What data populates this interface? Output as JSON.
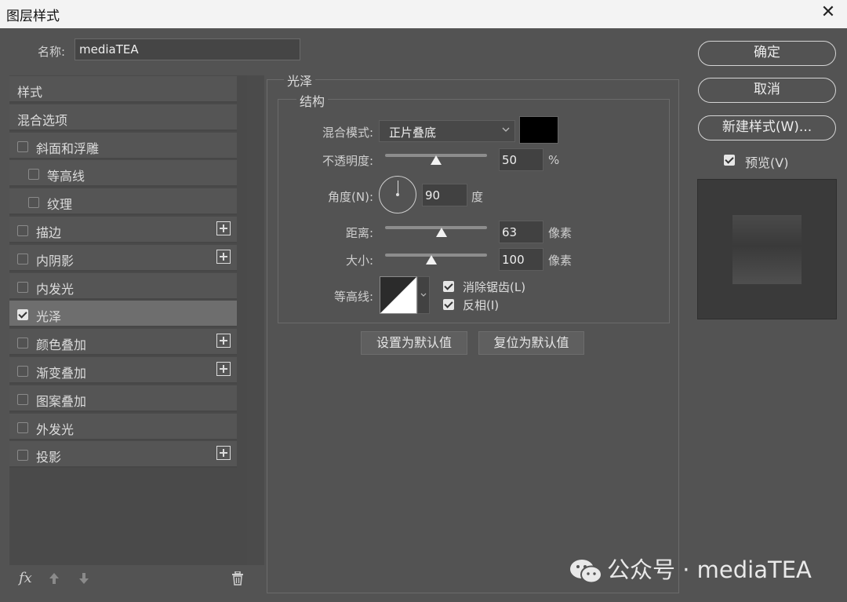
{
  "window": {
    "title": "图层样式",
    "close_glyph": "✕"
  },
  "name_field": {
    "label": "名称:",
    "value": "mediaTEA"
  },
  "styles_list": [
    {
      "label": "样式",
      "has_checkbox": false,
      "checked": false,
      "has_plus": false,
      "selected": false
    },
    {
      "label": "混合选项",
      "has_checkbox": false,
      "checked": false,
      "has_plus": false,
      "selected": false
    },
    {
      "label": "斜面和浮雕",
      "has_checkbox": true,
      "checked": false,
      "has_plus": false,
      "selected": false
    },
    {
      "label": "等高线",
      "has_checkbox": true,
      "checked": false,
      "has_plus": false,
      "selected": false
    },
    {
      "label": "纹理",
      "has_checkbox": true,
      "checked": false,
      "has_plus": false,
      "selected": false
    },
    {
      "label": "描边",
      "has_checkbox": true,
      "checked": false,
      "has_plus": true,
      "selected": false
    },
    {
      "label": "内阴影",
      "has_checkbox": true,
      "checked": false,
      "has_plus": true,
      "selected": false
    },
    {
      "label": "内发光",
      "has_checkbox": true,
      "checked": false,
      "has_plus": false,
      "selected": false
    },
    {
      "label": "光泽",
      "has_checkbox": true,
      "checked": true,
      "has_plus": false,
      "selected": true
    },
    {
      "label": "颜色叠加",
      "has_checkbox": true,
      "checked": false,
      "has_plus": true,
      "selected": false
    },
    {
      "label": "渐变叠加",
      "has_checkbox": true,
      "checked": false,
      "has_plus": true,
      "selected": false
    },
    {
      "label": "图案叠加",
      "has_checkbox": true,
      "checked": false,
      "has_plus": false,
      "selected": false
    },
    {
      "label": "外发光",
      "has_checkbox": true,
      "checked": false,
      "has_plus": false,
      "selected": false
    },
    {
      "label": "投影",
      "has_checkbox": true,
      "checked": false,
      "has_plus": true,
      "selected": false
    }
  ],
  "bottom_toolbar": {
    "fx_label": "fx",
    "up_icon": "arrow-up-icon",
    "down_icon": "arrow-down-icon",
    "trash_icon": "trash-icon"
  },
  "satin": {
    "section_title": "光泽",
    "structure_title": "结构",
    "blend_mode": {
      "label": "混合模式:",
      "value": "正片叠底",
      "color": "#000000"
    },
    "opacity": {
      "label": "不透明度:",
      "value": "50",
      "unit": "%",
      "fraction": 0.5
    },
    "angle": {
      "label": "角度(N):",
      "value": "90",
      "unit": "度"
    },
    "distance": {
      "label": "距离:",
      "value": "63",
      "unit": "像素",
      "fraction": 0.55
    },
    "size": {
      "label": "大小:",
      "value": "100",
      "unit": "像素",
      "fraction": 0.45
    },
    "contour": {
      "label": "等高线:"
    },
    "anti_alias": {
      "label": "消除锯齿(L)",
      "checked": true
    },
    "invert": {
      "label": "反相(I)",
      "checked": true
    },
    "set_default": "设置为默认值",
    "reset_default": "复位为默认值"
  },
  "actions": {
    "ok": "确定",
    "cancel": "取消",
    "new_style": "新建样式(W)...",
    "preview_label": "预览(V)",
    "preview_checked": true
  },
  "watermark": {
    "text": "公众号 · mediaTEA"
  }
}
